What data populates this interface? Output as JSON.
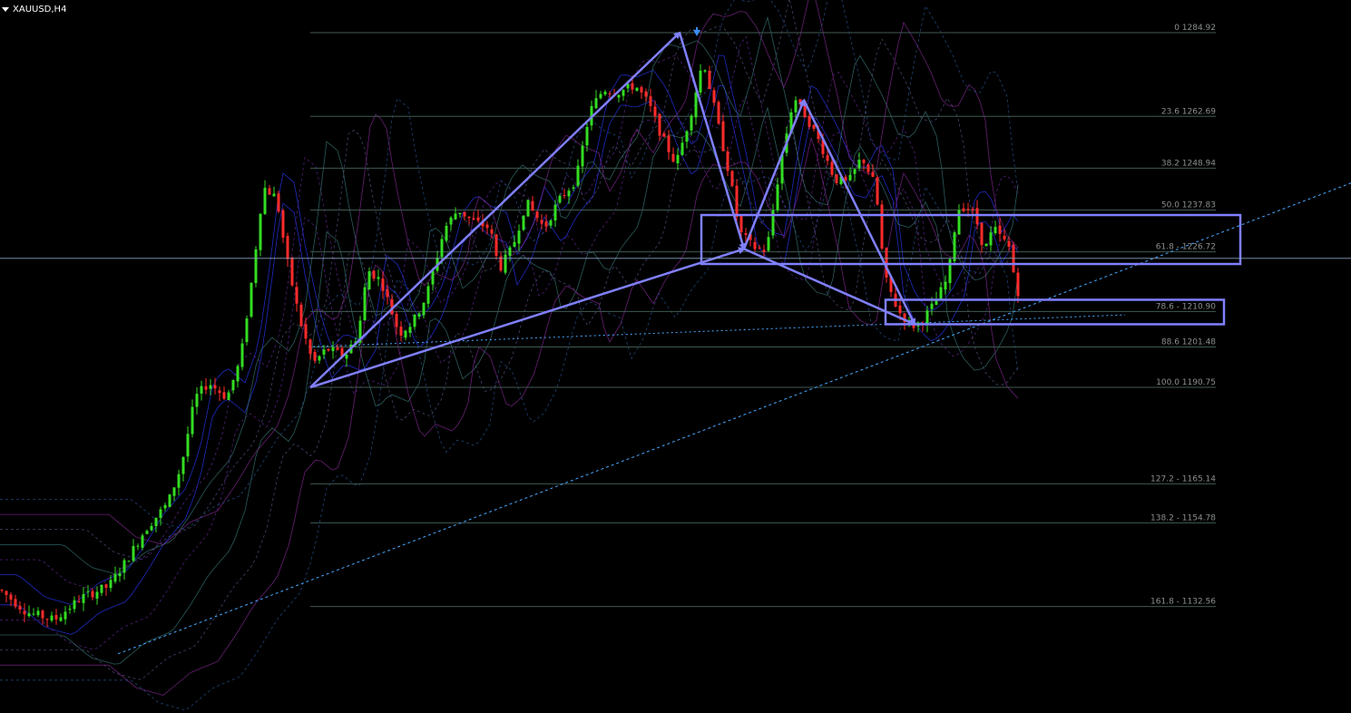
{
  "chart": {
    "symbol": "XAUUSD,H4",
    "timeframe_menu_icon": "dropdown-arrow-icon"
  },
  "colors": {
    "background": "#000000",
    "bull_candle": "#33dd22",
    "bear_candle": "#ff2b2b",
    "fib_line": "#3f5a52",
    "fib_label": "#8a8f8a",
    "pattern": "#8080ff",
    "trendline": "#4aa8ff",
    "crosshair": "#8aa0c0"
  },
  "chart_data": {
    "type": "candlestick",
    "title": "XAUUSD,H4",
    "ylim": [
      1120,
      1300
    ],
    "fibonacci_levels": [
      {
        "label": "0 1284.92",
        "value": 1284.92
      },
      {
        "label": "23.6 1262.69",
        "value": 1262.69
      },
      {
        "label": "38.2 1248.94",
        "value": 1248.94
      },
      {
        "label": "50.0 1237.83",
        "value": 1237.83
      },
      {
        "label": "61.8 - 1226.72",
        "value": 1226.72
      },
      {
        "label": "78.6 - 1210.90",
        "value": 1210.9
      },
      {
        "label": "88.6 1201.48",
        "value": 1201.48
      },
      {
        "label": "100.0 1190.75",
        "value": 1190.75
      },
      {
        "label": "127.2 - 1165.14",
        "value": 1165.14
      },
      {
        "label": "138.2 - 1154.78",
        "value": 1154.78
      },
      {
        "label": "161.8 - 1132.56",
        "value": 1132.56
      }
    ],
    "price_path": [
      [
        0,
        1137
      ],
      [
        30,
        1131
      ],
      [
        60,
        1129
      ],
      [
        90,
        1135
      ],
      [
        120,
        1138
      ],
      [
        140,
        1145
      ],
      [
        160,
        1153
      ],
      [
        185,
        1160
      ],
      [
        200,
        1170
      ],
      [
        215,
        1188
      ],
      [
        230,
        1192
      ],
      [
        250,
        1188
      ],
      [
        265,
        1198
      ],
      [
        278,
        1220
      ],
      [
        290,
        1244
      ],
      [
        305,
        1241
      ],
      [
        315,
        1226
      ],
      [
        330,
        1209
      ],
      [
        345,
        1197
      ],
      [
        360,
        1201
      ],
      [
        380,
        1199
      ],
      [
        395,
        1205
      ],
      [
        405,
        1222
      ],
      [
        420,
        1219
      ],
      [
        440,
        1205
      ],
      [
        455,
        1208
      ],
      [
        470,
        1215
      ],
      [
        490,
        1233
      ],
      [
        505,
        1238
      ],
      [
        520,
        1235
      ],
      [
        540,
        1233
      ],
      [
        550,
        1222
      ],
      [
        565,
        1228
      ],
      [
        580,
        1240
      ],
      [
        600,
        1233
      ],
      [
        615,
        1240
      ],
      [
        635,
        1246
      ],
      [
        650,
        1264
      ],
      [
        665,
        1270
      ],
      [
        680,
        1269
      ],
      [
        700,
        1271
      ],
      [
        715,
        1266
      ],
      [
        730,
        1257
      ],
      [
        745,
        1250
      ],
      [
        760,
        1262
      ],
      [
        775,
        1278
      ],
      [
        790,
        1262
      ],
      [
        805,
        1246
      ],
      [
        815,
        1232
      ],
      [
        830,
        1228
      ],
      [
        845,
        1227
      ],
      [
        860,
        1250
      ],
      [
        875,
        1268
      ],
      [
        890,
        1262
      ],
      [
        905,
        1255
      ],
      [
        920,
        1246
      ],
      [
        935,
        1245
      ],
      [
        950,
        1252
      ],
      [
        965,
        1244
      ],
      [
        975,
        1220
      ],
      [
        990,
        1211
      ],
      [
        1005,
        1207
      ],
      [
        1015,
        1208
      ],
      [
        1030,
        1213
      ],
      [
        1045,
        1220
      ],
      [
        1055,
        1238
      ],
      [
        1065,
        1239
      ],
      [
        1075,
        1236
      ],
      [
        1085,
        1227
      ],
      [
        1095,
        1233
      ],
      [
        1105,
        1230
      ],
      [
        1115,
        1227
      ],
      [
        1120,
        1213
      ],
      [
        1125,
        1221
      ]
    ],
    "harmonic_pattern": {
      "points": [
        [
          342,
          1190.75
        ],
        [
          749,
          1284.92
        ],
        [
          820,
          1227.5
        ],
        [
          886,
          1267
        ],
        [
          1008,
          1207.5
        ]
      ],
      "x_to_b": [
        [
          342,
          1190.75
        ],
        [
          820,
          1227.5
        ]
      ],
      "b_to_d": [
        [
          820,
          1227.5
        ],
        [
          1008,
          1207.5
        ]
      ]
    },
    "zones": [
      {
        "name": "upper-zone",
        "x": [
          773,
          1367
        ],
        "y": [
          1223.5,
          1236.5
        ]
      },
      {
        "name": "lower-zone",
        "x": [
          976,
          1349
        ],
        "y": [
          1207.5,
          1214
        ]
      }
    ],
    "trendline": [
      [
        130,
        1120
      ],
      [
        1489,
        1245
      ]
    ],
    "dotted_level": [
      [
        340,
        1201.5
      ],
      [
        1240,
        1210
      ]
    ],
    "crosshair_price": 1225
  }
}
